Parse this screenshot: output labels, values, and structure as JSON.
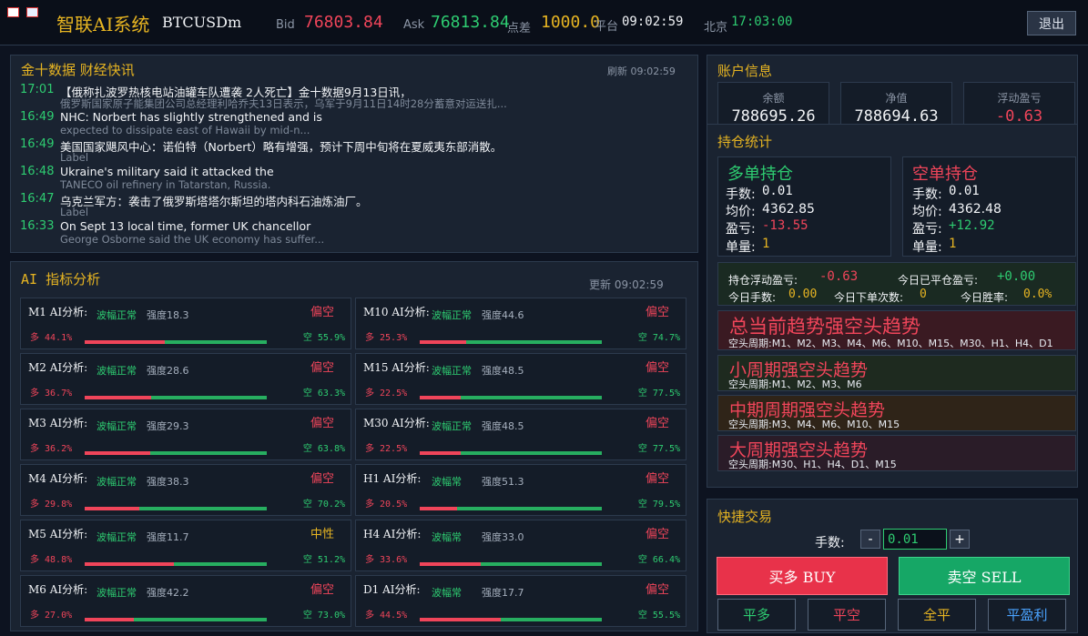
{
  "header": {
    "app_title": "智联AI系统",
    "symbol": "BTCUSDm",
    "bid_label": "Bid",
    "bid": "76803.84",
    "ask_label": "Ask",
    "ask": "76813.84",
    "spread_label": "点差",
    "spread": "1000.0",
    "platform_label": "平台",
    "platform_time": "09:02:59",
    "beijing_label": "北京",
    "beijing_time": "17:03:00",
    "exit_label": "退出"
  },
  "news": {
    "title": "金十数据 财经快讯",
    "refresh_label": "刷新 09:02:59",
    "items": [
      {
        "time": "17:01",
        "title": "【俄称扎波罗热核电站油罐车队遭袭 2人死亡】金十数据9月13日讯，",
        "sub": "俄罗斯国家原子能集团公司总经理利哈乔夫13日表示，乌军于9月11日14时28分蓄意对运送扎..."
      },
      {
        "time": "16:49",
        "title": "NHC: Norbert has slightly strengthened and is",
        "sub": "expected to dissipate east of Hawaii by mid-n..."
      },
      {
        "time": "16:49",
        "title": "美国国家飓风中心：诺伯特（Norbert）略有增强，预计下周中旬将在夏威夷东部消散。",
        "sub": "Label"
      },
      {
        "time": "16:48",
        "title": "Ukraine's military said it attacked the",
        "sub": "TANECO oil refinery in Tatarstan, Russia."
      },
      {
        "time": "16:47",
        "title": "乌克兰军方：袭击了俄罗斯塔塔尔斯坦的塔内科石油炼油厂。",
        "sub": "Label"
      },
      {
        "time": "16:33",
        "title": "On Sept 13 local time, former UK chancellor",
        "sub": "George Osborne said the UK economy has suffer..."
      }
    ]
  },
  "ai": {
    "title": "AI 指标分析",
    "updated_label": "更新 09:02:59",
    "cards": [
      {
        "label": "M1 AI分析:",
        "status": "波幅正常",
        "strength": "强度18.3",
        "direction": "偏空",
        "dir_color": "#f0455a",
        "long_label": "多 44.1%",
        "short_label": "空 55.9%",
        "long_frac": 0.441
      },
      {
        "label": "M10 AI分析:",
        "status": "波幅正常",
        "strength": "强度44.6",
        "direction": "偏空",
        "dir_color": "#f0455a",
        "long_label": "多 25.3%",
        "short_label": "空 74.7%",
        "long_frac": 0.253
      },
      {
        "label": "M2 AI分析:",
        "status": "波幅正常",
        "strength": "强度28.6",
        "direction": "偏空",
        "dir_color": "#f0455a",
        "long_label": "多 36.7%",
        "short_label": "空 63.3%",
        "long_frac": 0.367
      },
      {
        "label": "M15 AI分析:",
        "status": "波幅正常",
        "strength": "强度48.5",
        "direction": "偏空",
        "dir_color": "#f0455a",
        "long_label": "多 22.5%",
        "short_label": "空 77.5%",
        "long_frac": 0.225
      },
      {
        "label": "M3 AI分析:",
        "status": "波幅正常",
        "strength": "强度29.3",
        "direction": "偏空",
        "dir_color": "#f0455a",
        "long_label": "多 36.2%",
        "short_label": "空 63.8%",
        "long_frac": 0.362
      },
      {
        "label": "M30 AI分析:",
        "status": "波幅正常",
        "strength": "强度48.5",
        "direction": "偏空",
        "dir_color": "#f0455a",
        "long_label": "多 22.5%",
        "short_label": "空 77.5%",
        "long_frac": 0.225
      },
      {
        "label": "M4 AI分析:",
        "status": "波幅正常",
        "strength": "强度38.3",
        "direction": "偏空",
        "dir_color": "#f0455a",
        "long_label": "多 29.8%",
        "short_label": "空 70.2%",
        "long_frac": 0.298
      },
      {
        "label": "H1 AI分析:",
        "status": "波幅常",
        "strength": "强度51.3",
        "direction": "偏空",
        "dir_color": "#f0455a",
        "long_label": "多 20.5%",
        "short_label": "空 79.5%",
        "long_frac": 0.205
      },
      {
        "label": "M5 AI分析:",
        "status": "波幅正常",
        "strength": "强度11.7",
        "direction": "中性",
        "dir_color": "#e6b422",
        "long_label": "多 48.8%",
        "short_label": "空 51.2%",
        "long_frac": 0.488
      },
      {
        "label": "H4 AI分析:",
        "status": "波幅常",
        "strength": "强度33.0",
        "direction": "偏空",
        "dir_color": "#f0455a",
        "long_label": "多 33.6%",
        "short_label": "空 66.4%",
        "long_frac": 0.336
      },
      {
        "label": "M6 AI分析:",
        "status": "波幅正常",
        "strength": "强度42.2",
        "direction": "偏空",
        "dir_color": "#f0455a",
        "long_label": "多 27.0%",
        "short_label": "空 73.0%",
        "long_frac": 0.27
      },
      {
        "label": "D1 AI分析:",
        "status": "波幅常",
        "strength": "强度17.7",
        "direction": "偏空",
        "dir_color": "#f0455a",
        "long_label": "多 44.5%",
        "short_label": "空 55.5%",
        "long_frac": 0.445
      }
    ]
  },
  "account": {
    "title": "账户信息",
    "balance_label": "余额",
    "balance": "788695.26",
    "equity_label": "净值",
    "equity": "788694.63",
    "float_label": "浮动盈亏",
    "float": "-0.63"
  },
  "positions": {
    "title": "持仓统计",
    "long": {
      "title": "多单持仓",
      "lots_label": "手数:",
      "lots": "0.01",
      "avg_label": "均价:",
      "avg": "4362.85",
      "pnl_label": "盈亏:",
      "pnl": "-13.55",
      "count_label": "单量:",
      "count": "1"
    },
    "short": {
      "title": "空单持仓",
      "lots_label": "手数:",
      "lots": "0.01",
      "avg_label": "均价:",
      "avg": "4362.48",
      "pnl_label": "盈亏:",
      "pnl": "+12.92",
      "count_label": "单量:",
      "count": "1"
    }
  },
  "stats": {
    "hold_float_label": "持仓浮动盈亏:",
    "hold_float": "-0.63",
    "closed_label": "今日已平仓盈亏:",
    "closed": "+0.00",
    "today_lots_label": "今日手数:",
    "today_lots": "0.00",
    "orders_label": "今日下单次数:",
    "orders": "0",
    "winrate_label": "今日胜率:",
    "winrate": "0.0%"
  },
  "trends": [
    {
      "title": "总当前趋势强空头趋势",
      "sub": "空头周期:M1、M2、M3、M4、M6、M10、M15、M30、H1、H4、D1",
      "bg": "#3a1a22"
    },
    {
      "title": "小周期强空头趋势",
      "sub": "空头周期:M1、M2、M3、M6",
      "bg": "#1e2a1f"
    },
    {
      "title": "中期周期强空头趋势",
      "sub": "空头周期:M3、M4、M6、M10、M15",
      "bg": "#2f2418"
    },
    {
      "title": "大周期强空头趋势",
      "sub": "空头周期:M30、H1、H4、D1、M15",
      "bg": "#2a1c28"
    }
  ],
  "trade": {
    "title": "快捷交易",
    "lots_label": "手数:",
    "minus": "-",
    "plus": "+",
    "lots_value": "0.01",
    "buy_label": "买多 BUY",
    "sell_label": "卖空 SELL",
    "close_long": "平多",
    "close_short": "平空",
    "close_all": "全平",
    "close_profit": "平盈利"
  }
}
